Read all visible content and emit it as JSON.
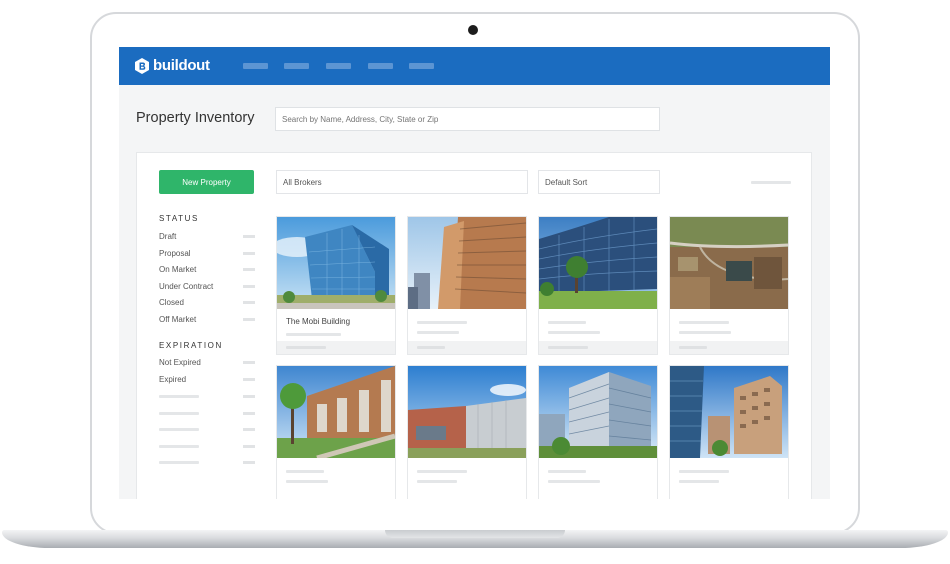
{
  "app": {
    "brand": "buildout",
    "page_title": "Property Inventory",
    "brand_color": "#1b6cc0",
    "accent_color": "#2fb56a"
  },
  "search": {
    "placeholder": "Search by Name, Address, City, State or Zip"
  },
  "toolbar": {
    "new_property_label": "New Property",
    "brokers_value": "All Brokers",
    "sort_value": "Default Sort"
  },
  "sidebar": {
    "status_heading": "STATUS",
    "status_items": [
      "Draft",
      "Proposal",
      "On Market",
      "Under Contract",
      "Closed",
      "Off Market"
    ],
    "expiration_heading": "EXPIRATION",
    "expiration_items": [
      "Not Expired",
      "Expired"
    ]
  },
  "cards": [
    {
      "title": "The Mobi Building",
      "image": "glass-office-tower"
    },
    {
      "title": "",
      "image": "brick-highrise"
    },
    {
      "title": "",
      "image": "curved-glass-building"
    },
    {
      "title": "",
      "image": "aerial-construction-site"
    },
    {
      "title": "",
      "image": "townhouse-row"
    },
    {
      "title": "",
      "image": "low-rise-office"
    },
    {
      "title": "",
      "image": "blue-office-block"
    },
    {
      "title": "",
      "image": "mixed-highrise-street"
    }
  ]
}
